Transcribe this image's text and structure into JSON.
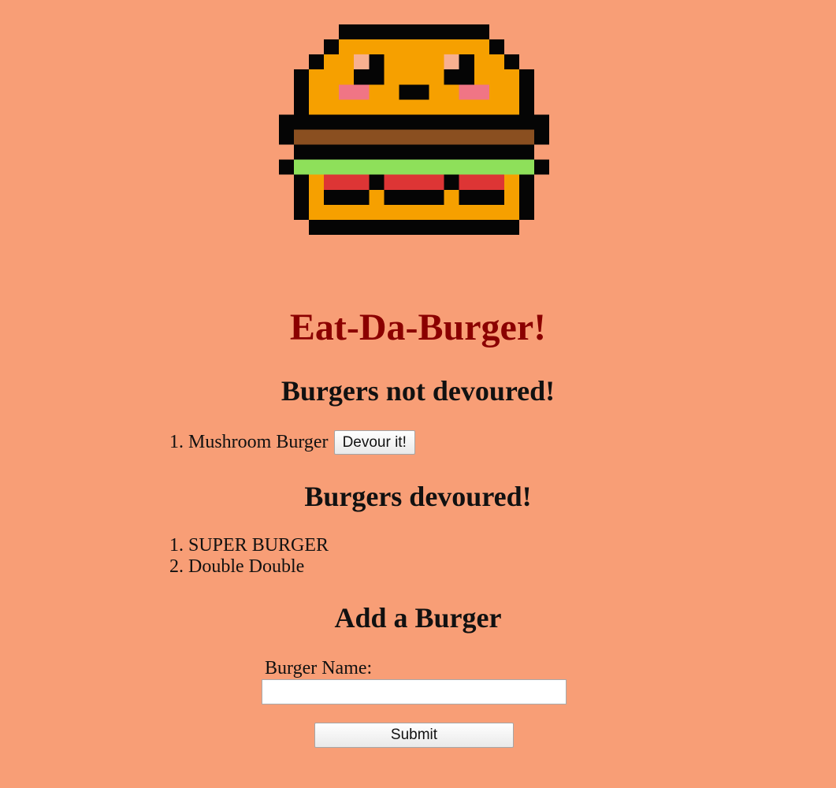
{
  "header": {
    "title": "Eat-Da-Burger!"
  },
  "colors": {
    "background": "#f89e76",
    "title": "#8b0000",
    "bun": "#f6a000",
    "patty": "#8a4f20",
    "lettuce": "#8ee05a",
    "tomato": "#dd3535",
    "cheek": "#f07585",
    "cheek_highlight": "#f8b090",
    "outline": "#050505"
  },
  "not_devoured": {
    "heading": "Burgers not devoured!",
    "items": [
      {
        "number": "1.",
        "name": "Mushroom Burger",
        "button_label": "Devour it!"
      }
    ]
  },
  "devoured": {
    "heading": "Burgers devoured!",
    "items": [
      {
        "number": "1.",
        "name": "SUPER BURGER"
      },
      {
        "number": "2.",
        "name": "Double Double"
      }
    ]
  },
  "add_form": {
    "heading": "Add a Burger",
    "label": "Burger Name:",
    "input_value": "",
    "submit_label": "Submit"
  }
}
